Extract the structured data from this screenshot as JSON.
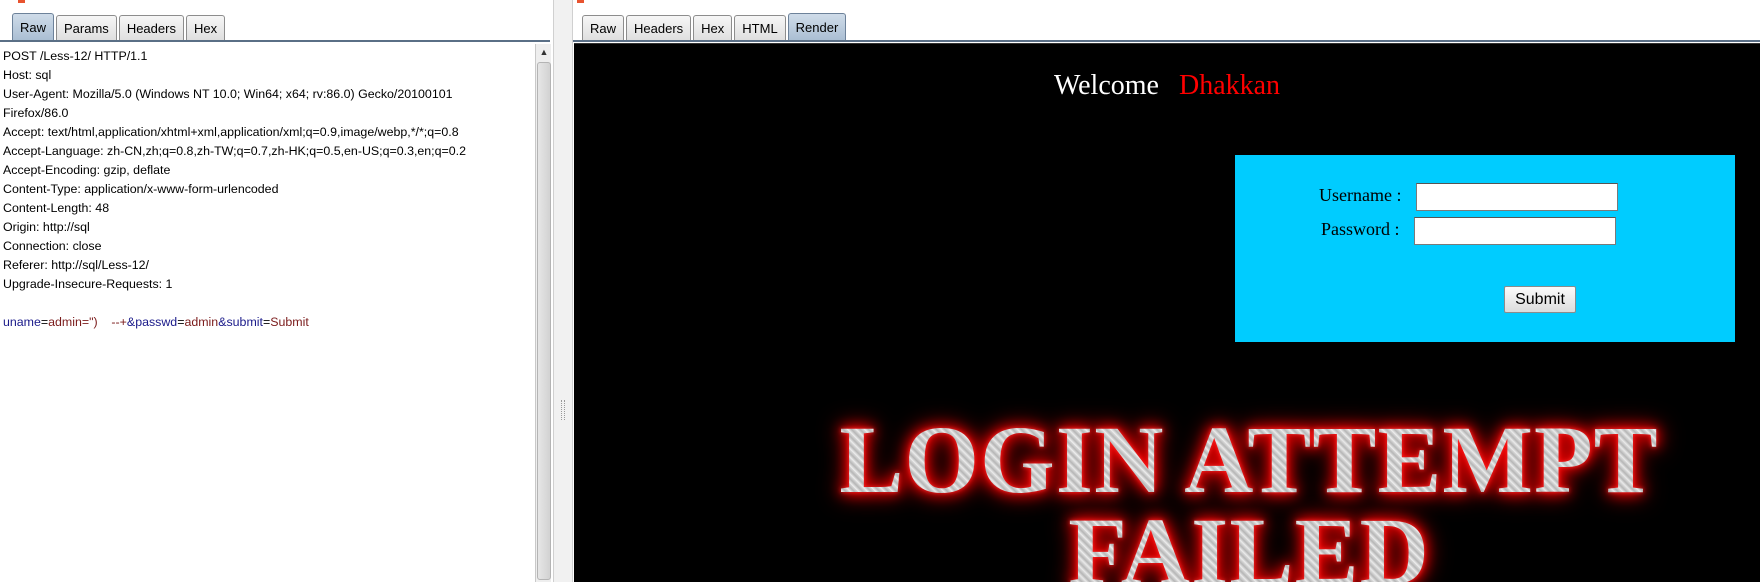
{
  "request_pane": {
    "tabs": [
      {
        "label": "Raw",
        "active": true
      },
      {
        "label": "Params",
        "active": false
      },
      {
        "label": "Headers",
        "active": false
      },
      {
        "label": "Hex",
        "active": false
      }
    ],
    "lines": [
      "POST /Less-12/ HTTP/1.1",
      "Host: sql",
      "User-Agent: Mozilla/5.0 (Windows NT 10.0; Win64; x64; rv:86.0) Gecko/20100101",
      "Firefox/86.0",
      "Accept: text/html,application/xhtml+xml,application/xml;q=0.9,image/webp,*/*;q=0.8",
      "Accept-Language: zh-CN,zh;q=0.8,zh-TW;q=0.7,zh-HK;q=0.5,en-US;q=0.3,en;q=0.2",
      "Accept-Encoding: gzip, deflate",
      "Content-Type: application/x-www-form-urlencoded",
      "Content-Length: 48",
      "Origin: http://sql",
      "Connection: close",
      "Referer: http://sql/Less-12/",
      "Upgrade-Insecure-Requests: 1"
    ],
    "body_params": {
      "p1_name": "uname",
      "p1_eq": "=",
      "p1_value": "admin=\")    --+",
      "amp1": "&",
      "p2_name": "passwd",
      "p2_eq": "=",
      "p2_value": "admin",
      "amp2": "&",
      "p3_name": "submit",
      "p3_eq": "=",
      "p3_value": "Submit"
    },
    "scroll_up_glyph": "▲"
  },
  "response_pane": {
    "tabs": [
      {
        "label": "Raw",
        "active": false
      },
      {
        "label": "Headers",
        "active": false
      },
      {
        "label": "Hex",
        "active": false
      },
      {
        "label": "HTML",
        "active": false
      },
      {
        "label": "Render",
        "active": true
      }
    ],
    "render": {
      "welcome_word": "Welcome",
      "welcome_name": "Dhakkan",
      "username_label": "Username :",
      "password_label": "Password :",
      "username_value": "",
      "password_value": "",
      "submit_label": "Submit",
      "fail_line1": "LOGIN ATTEMPT",
      "fail_line2": "FAILED"
    }
  },
  "colors": {
    "accent_top": "#e8532f",
    "render_bg": "#000000",
    "login_box_bg": "#00ccff",
    "welcome_name": "#ff0000",
    "param_name": "#1a1a8a",
    "param_value": "#7a1a1a"
  }
}
